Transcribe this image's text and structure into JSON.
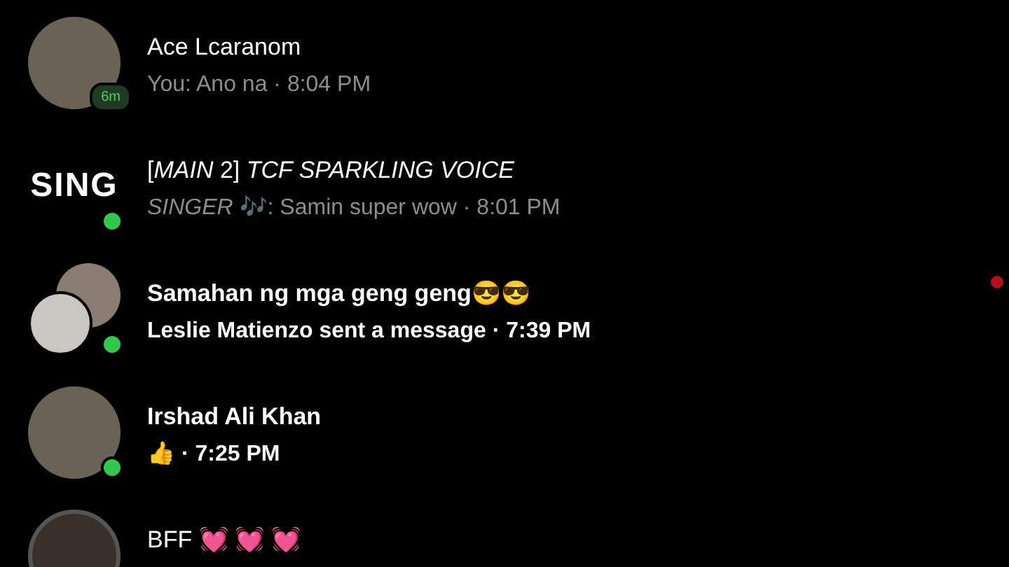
{
  "conversations": [
    {
      "name": "Ace Lcaranom",
      "preview": "You: Ano na · 8:04 PM",
      "unread": false,
      "avatar": {
        "kind": "photo",
        "ring": false
      },
      "online": false,
      "active_badge": "6m"
    },
    {
      "name": "[*MAIN* 2] *TCF SPARKLING VOICE*",
      "preview": "*SINGER* 🎶: Samin super wow · 8:01 PM",
      "unread": false,
      "avatar": {
        "kind": "logo",
        "logo_text": "SING"
      },
      "online": true
    },
    {
      "name": "Samahan ng mga geng geng😎😎",
      "preview": "Leslie Matienzo sent a message · 7:39 PM",
      "unread": true,
      "avatar": {
        "kind": "group"
      },
      "online": true
    },
    {
      "name": "Irshad Ali Khan",
      "preview": "👍 · 7:25 PM",
      "unread": true,
      "avatar": {
        "kind": "photo",
        "ring": false
      },
      "online": true
    },
    {
      "name": "BFF 💓 💓 💓",
      "unread": false,
      "avatar": {
        "kind": "photo",
        "ring": true
      },
      "online": false
    }
  ]
}
